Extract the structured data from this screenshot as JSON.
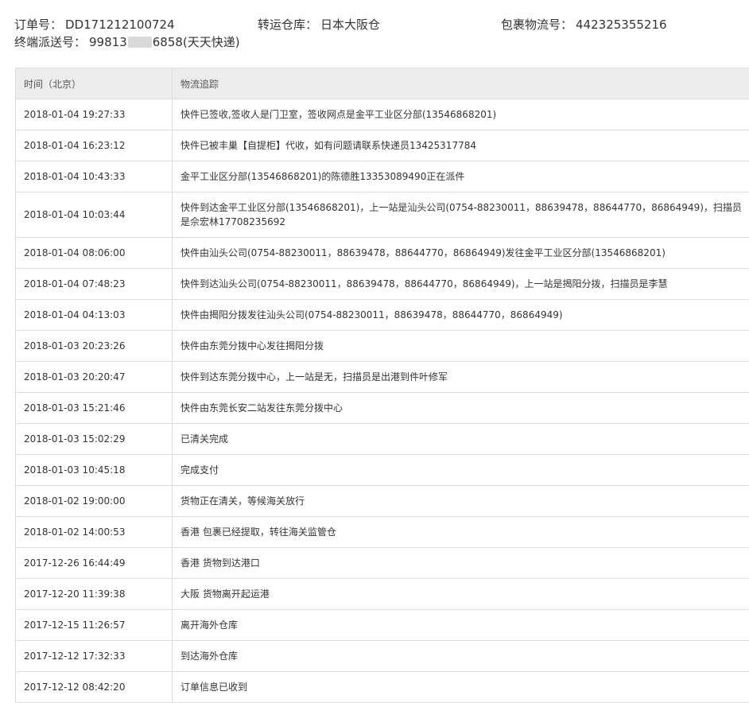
{
  "info": {
    "order_label": "订单号：",
    "order_value": "DD171212100724",
    "warehouse_label": "转运仓库：",
    "warehouse_value": "日本大阪仓",
    "tracking_label": "包裹物流号：",
    "tracking_value": "442325355216",
    "final_label": "终端派送号：",
    "final_value_prefix": "99813",
    "final_value_suffix": "6858(天天快递)"
  },
  "table": {
    "headers": {
      "time": "时间（北京）",
      "tracking": "物流追踪"
    },
    "rows": [
      {
        "time": "2018-01-04 19:27:33",
        "text": "快件已签收,签收人是门卫室，签收网点是金平工业区分部(13546868201)"
      },
      {
        "time": "2018-01-04 16:23:12",
        "text": "快件已被丰巢【自提柜】代收，如有问题请联系快递员13425317784"
      },
      {
        "time": "2018-01-04 10:43:33",
        "text": "金平工业区分部(13546868201)的陈德胜13353089490正在派件"
      },
      {
        "time": "2018-01-04 10:03:44",
        "text": "快件到达金平工业区分部(13546868201)，上一站是汕头公司(0754-88230011，88639478，88644770，86864949)，扫描员是佘宏林17708235692"
      },
      {
        "time": "2018-01-04 08:06:00",
        "text": "快件由汕头公司(0754-88230011，88639478，88644770，86864949)发往金平工业区分部(13546868201)"
      },
      {
        "time": "2018-01-04 07:48:23",
        "text": "快件到达汕头公司(0754-88230011，88639478，88644770，86864949)，上一站是揭阳分拨，扫描员是李慧"
      },
      {
        "time": "2018-01-04 04:13:03",
        "text": "快件由揭阳分拨发往汕头公司(0754-88230011，88639478，88644770，86864949)"
      },
      {
        "time": "2018-01-03 20:23:26",
        "text": "快件由东莞分拨中心发往揭阳分拨"
      },
      {
        "time": "2018-01-03 20:20:47",
        "text": "快件到达东莞分拨中心，上一站是无，扫描员是出港到件叶修军"
      },
      {
        "time": "2018-01-03 15:21:46",
        "text": "快件由东莞长安二站发往东莞分拨中心"
      },
      {
        "time": "2018-01-03 15:02:29",
        "text": "已清关完成"
      },
      {
        "time": "2018-01-03 10:45:18",
        "text": "完成支付"
      },
      {
        "time": "2018-01-02 19:00:00",
        "text": "货物正在清关，等候海关放行"
      },
      {
        "time": "2018-01-02 14:00:53",
        "text": "香港 包裹已经提取，转往海关监管仓"
      },
      {
        "time": "2017-12-26 16:44:49",
        "text": "香港 货物到达港口"
      },
      {
        "time": "2017-12-20 11:39:38",
        "text": "大阪 货物离开起运港"
      },
      {
        "time": "2017-12-15 11:26:57",
        "text": "离开海外仓库"
      },
      {
        "time": "2017-12-12 17:32:33",
        "text": "到达海外仓库"
      },
      {
        "time": "2017-12-12 08:42:20",
        "text": "订单信息已收到"
      }
    ]
  }
}
